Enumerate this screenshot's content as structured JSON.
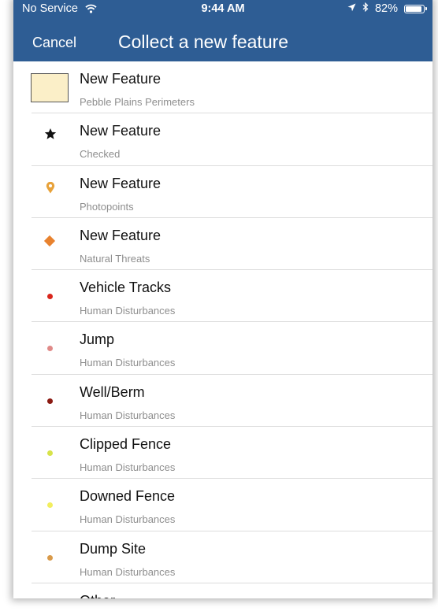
{
  "status_bar": {
    "carrier": "No Service",
    "time": "9:44 AM",
    "battery_percent": "82%",
    "battery_level": 0.82,
    "icons": [
      "wifi-icon",
      "location-arrow-icon",
      "bluetooth-icon",
      "battery-icon"
    ]
  },
  "nav": {
    "cancel_label": "Cancel",
    "title": "Collect a new feature"
  },
  "features": [
    {
      "label": "New Feature",
      "layer": "Pebble Plains Perimeters",
      "symbol": "rectangle",
      "color": "#fbefc8"
    },
    {
      "label": "New Feature",
      "layer": "Checked",
      "symbol": "star",
      "color": "#111111"
    },
    {
      "label": "New Feature",
      "layer": "Photopoints",
      "symbol": "pin",
      "color": "#e8a23a"
    },
    {
      "label": "New Feature",
      "layer": "Natural Threats",
      "symbol": "diamond",
      "color": "#e8822e"
    },
    {
      "label": "Vehicle Tracks",
      "layer": "Human Disturbances",
      "symbol": "dot",
      "color": "#d9261c"
    },
    {
      "label": "Jump",
      "layer": "Human Disturbances",
      "symbol": "dot",
      "color": "#e08a88"
    },
    {
      "label": "Well/Berm",
      "layer": "Human Disturbances",
      "symbol": "dot",
      "color": "#8b1a12"
    },
    {
      "label": "Clipped Fence",
      "layer": "Human Disturbances",
      "symbol": "dot",
      "color": "#d7e34a"
    },
    {
      "label": "Downed Fence",
      "layer": "Human Disturbances",
      "symbol": "dot",
      "color": "#f2ee5e"
    },
    {
      "label": "Dump Site",
      "layer": "Human Disturbances",
      "symbol": "dot",
      "color": "#d99a4a"
    },
    {
      "label": "Other",
      "layer": "",
      "symbol": "dot",
      "color": "#9a9a9a"
    }
  ],
  "colors": {
    "nav_background": "#2e5d94",
    "nav_text": "#ffffff",
    "subtitle_text": "#8e8e8e"
  }
}
